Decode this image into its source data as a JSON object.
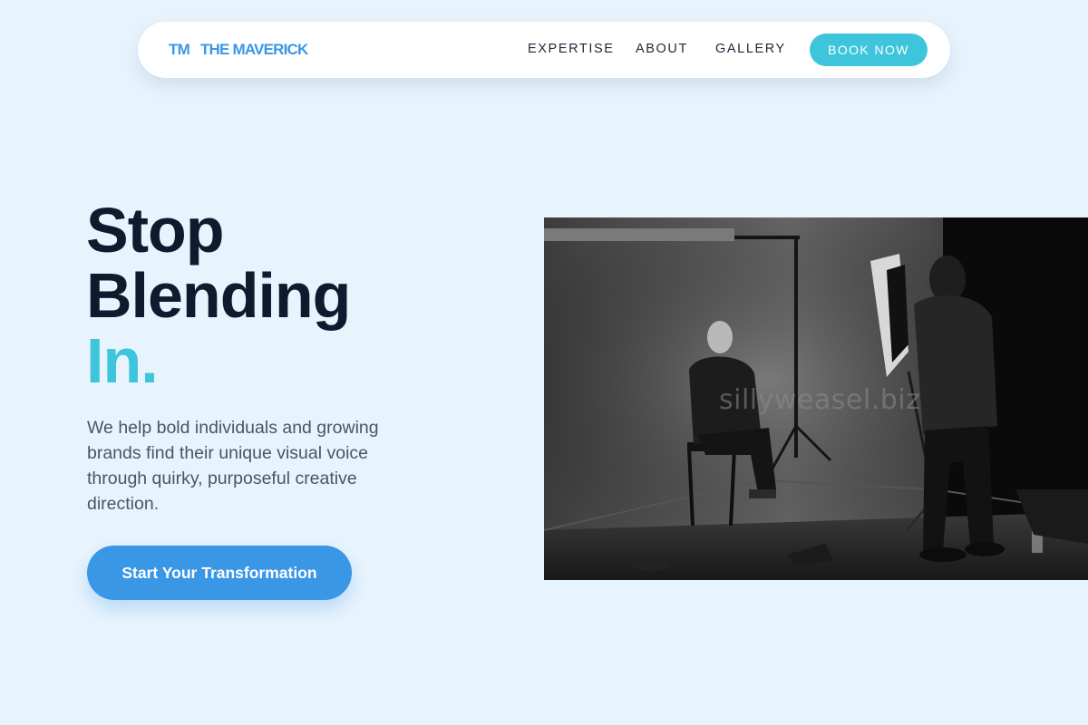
{
  "nav": {
    "logo_mark": "TM",
    "logo_text": "THE MAVERICK",
    "links": [
      "EXPERTISE",
      "ABOUT",
      "GALLERY"
    ],
    "cta_label": "BOOK NOW"
  },
  "hero": {
    "headline_line1": "Stop",
    "headline_line2": "Blending",
    "headline_line3": "In.",
    "subtext": "We help bold individuals and growing brands find their unique visual voice through quirky, purposeful creative direction.",
    "cta_label": "Start Your Transformation"
  },
  "photo": {
    "watermark": "sillyweasel.biz"
  },
  "colors": {
    "background": "#e8f4fd",
    "primary": "#3a97e6",
    "accent": "#3ec5dc",
    "heading": "#0f1a2e",
    "body_text": "#4b5563"
  }
}
